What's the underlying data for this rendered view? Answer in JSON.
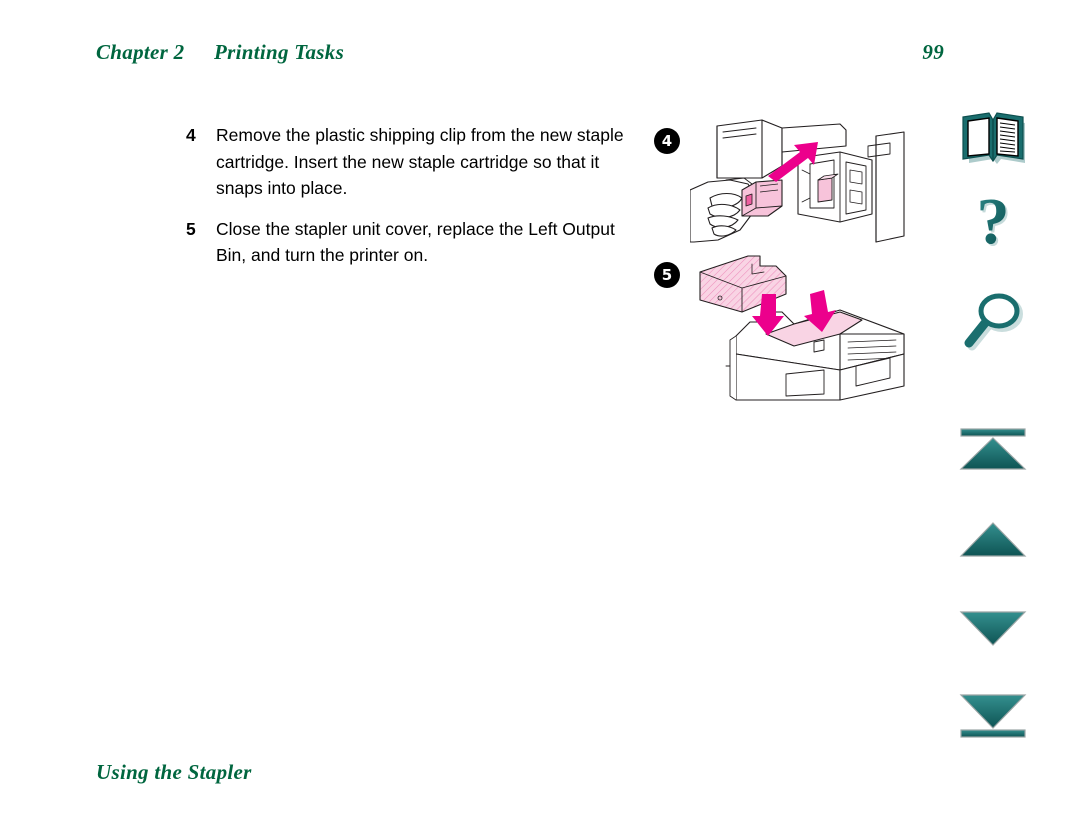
{
  "document": {
    "type": "printer-user-guide-page",
    "page_background": "#ffffff"
  },
  "header": {
    "chapter_label": "Chapter 2",
    "section_title": "Printing Tasks",
    "page_number": "99",
    "color": "#00663f"
  },
  "footer": {
    "title": "Using the Stapler",
    "color": "#00663f"
  },
  "body": {
    "steps": [
      {
        "number": "4",
        "text": "Remove the plastic shipping clip from the new staple cartridge. Insert the new staple cartridge so that it snaps into place."
      },
      {
        "number": "5",
        "text": "Close the stapler unit cover, replace the Left Output Bin, and turn the printer on."
      }
    ]
  },
  "illustrations": [
    {
      "badge": "4",
      "caption": "Hand inserting a new staple cartridge into the open stapler unit, magenta arrow indicating the insertion direction",
      "highlight_color": "#ec008c",
      "part_color": "#f7c3da"
    },
    {
      "badge": "5",
      "caption": "Left Output Bin being lowered back onto the printer, two magenta arrows indicating downward placement",
      "highlight_color": "#ec008c",
      "part_color": "#f9d4e4"
    }
  ],
  "sidebar": {
    "accent_color": "#1a6e6e",
    "items": [
      {
        "id": "book",
        "icon": "open-book-icon",
        "label": "Contents"
      },
      {
        "id": "help",
        "icon": "question-mark-icon",
        "label": "Help"
      },
      {
        "id": "search",
        "icon": "magnifying-glass-icon",
        "label": "Search"
      },
      {
        "id": "first",
        "icon": "first-page-icon",
        "label": "First Page"
      },
      {
        "id": "prev",
        "icon": "previous-page-icon",
        "label": "Previous Page"
      },
      {
        "id": "next",
        "icon": "next-page-icon",
        "label": "Next Page"
      },
      {
        "id": "last",
        "icon": "last-page-icon",
        "label": "Last Page"
      }
    ]
  }
}
